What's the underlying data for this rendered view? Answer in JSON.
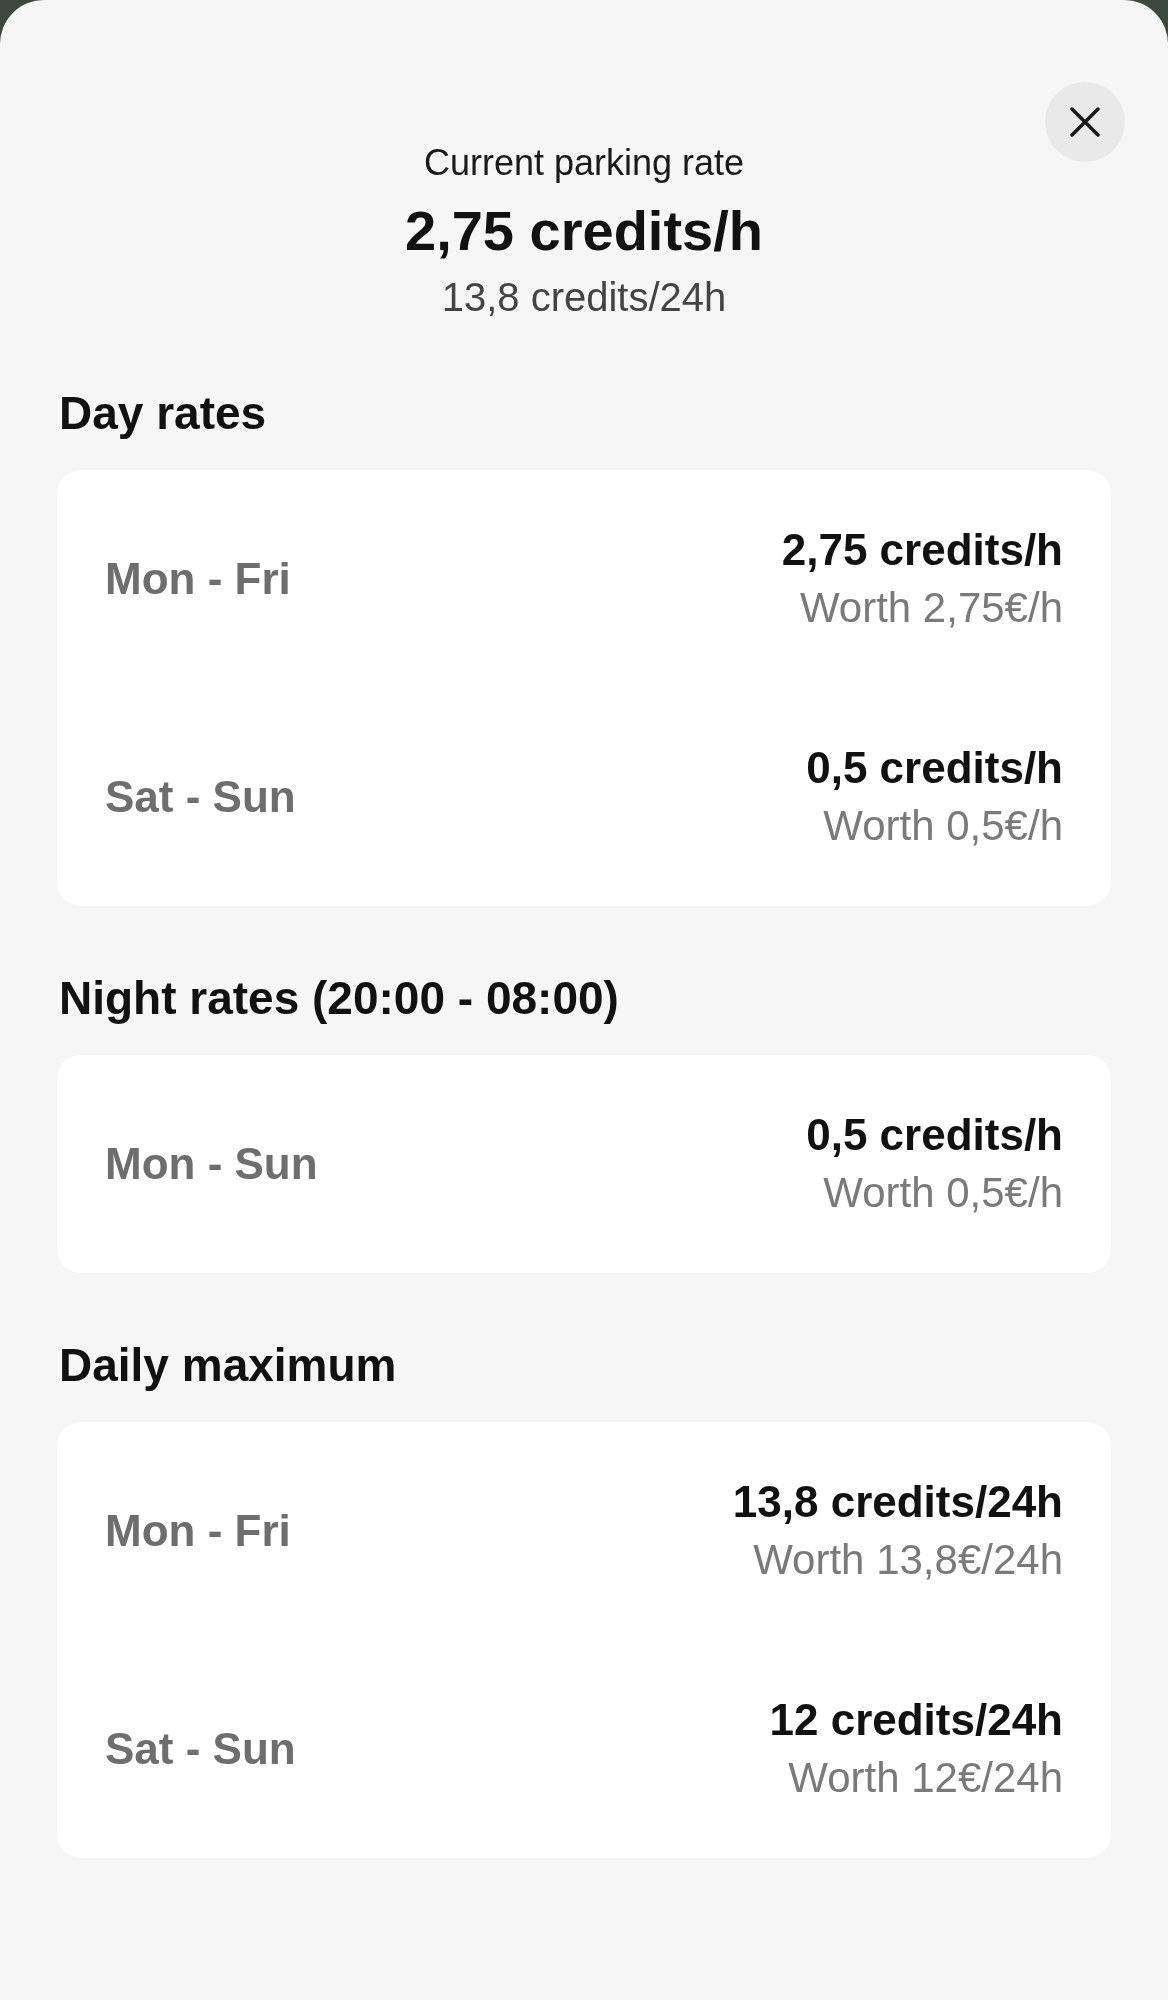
{
  "header": {
    "caption": "Current parking rate",
    "rate": "2,75 credits/h",
    "daily_rate": "13,8 credits/24h"
  },
  "sections": [
    {
      "title": "Day rates",
      "rows": [
        {
          "days": "Mon - Fri",
          "rate": "2,75 credits/h",
          "worth": "Worth 2,75€/h"
        },
        {
          "days": "Sat - Sun",
          "rate": "0,5 credits/h",
          "worth": "Worth 0,5€/h"
        }
      ]
    },
    {
      "title": "Night rates (20:00 - 08:00)",
      "rows": [
        {
          "days": "Mon - Sun",
          "rate": "0,5 credits/h",
          "worth": "Worth 0,5€/h"
        }
      ]
    },
    {
      "title": "Daily maximum",
      "rows": [
        {
          "days": "Mon - Fri",
          "rate": "13,8 credits/24h",
          "worth": "Worth 13,8€/24h"
        },
        {
          "days": "Sat - Sun",
          "rate": "12 credits/24h",
          "worth": "Worth 12€/24h"
        }
      ]
    }
  ]
}
